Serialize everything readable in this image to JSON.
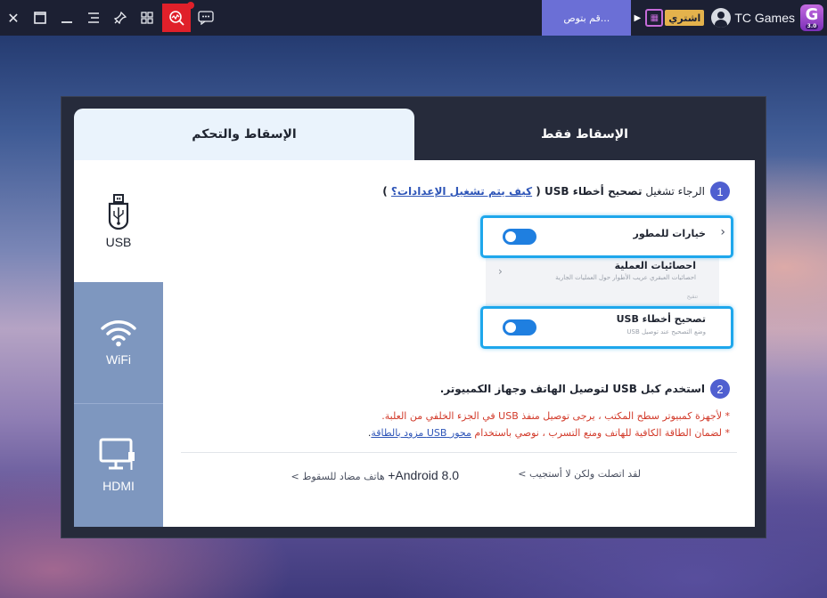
{
  "topbar": {
    "app_name": "TC Games",
    "logo_letter": "G",
    "logo_version": "3.0",
    "buy_label": "اشتري",
    "notice_text": "...قم بتوص",
    "icons": [
      "close-icon",
      "maximize-icon",
      "minimize-icon",
      "menu-icon",
      "pin-icon",
      "grid-icon",
      "search-chart-icon",
      "chat-icon"
    ]
  },
  "tabs": {
    "projection_control": "الإسقاط والتحكم",
    "projection_only": "الإسقاط فقط"
  },
  "sidebar": {
    "items": [
      {
        "label": "USB"
      },
      {
        "label": "WiFi"
      },
      {
        "label": "HDMI"
      }
    ]
  },
  "step1": {
    "num": "1",
    "prefix": "الرجاء تشغيل ",
    "bold": "تصحيح أخطاء USB",
    "paren_open": " ( ",
    "link": "كيف يتم تشغيل الإعدادات؟",
    "paren_close": " )"
  },
  "mock": {
    "developer_options": "خيارات للمطور",
    "process_stats": "احصائيات العملية",
    "process_stats_sub": "احصائيات العبقري عريب الأطوار حول العمليات الجارية",
    "section": "تنقيح",
    "usb_debugging": "تصحيح أخطاء USB",
    "usb_debugging_sub": "وضع التصحيح عند توصيل USB"
  },
  "step2": {
    "num": "2",
    "text": "استخدم كبل USB لتوصيل الهاتف وجهاز الكمبيوتر."
  },
  "notes": {
    "line1": "* لأجهزة كمبيوتر سطح المكتب ، يرجى توصيل منفذ USB في الجزء الخلفي من العلبة.",
    "line2_prefix": "* لضمان الطاقة الكافية للهاتف ومنع التسرب ، نوصي باستخدام ",
    "line2_link": "محور USB مزود بالطاقة",
    "line2_suffix": "."
  },
  "footer": {
    "connected_no_response": "لقد اتصلت ولكن لا أستجيب  >",
    "android_version": "Android 8.0+",
    "android_suffix": " هاتف مضاد للسقوط  >"
  }
}
